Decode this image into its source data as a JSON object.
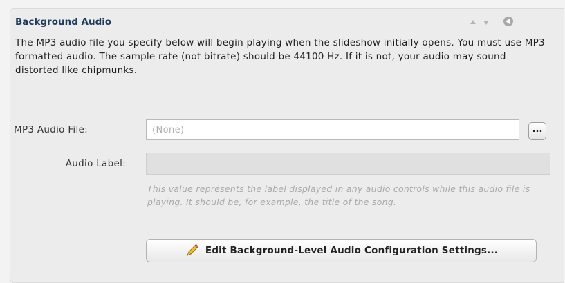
{
  "section": {
    "title": "Background Audio",
    "description": "The MP3 audio file you specify below will begin playing when the slideshow initially opens.  You must use MP3 formatted audio.  The sample rate (not bitrate) should be 44100 Hz.  If it is not, your audio may sound distorted like chipmunks."
  },
  "fields": {
    "mp3_file": {
      "label": "MP3 Audio File:",
      "value": "(None)",
      "browse_label": "..."
    },
    "audio_label": {
      "label": "Audio Label:",
      "value": ""
    },
    "hint": "This value represents the label displayed in any audio controls while this audio file is playing.  It should be, for example, the title of the song."
  },
  "actions": {
    "edit_button": "Edit Background-Level Audio Configuration Settings..."
  },
  "icons": [
    "move-up-icon",
    "move-down-icon",
    "collapse-icon",
    "pencil-icon"
  ]
}
